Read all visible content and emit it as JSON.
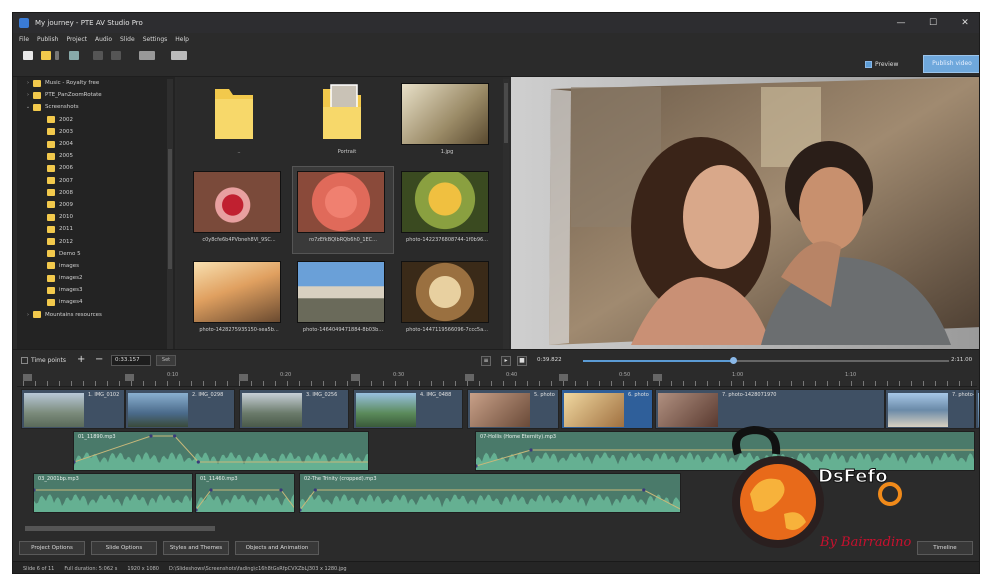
{
  "window": {
    "title": "My journey - PTE AV Studio Pro"
  },
  "menu": [
    "File",
    "Publish",
    "Project",
    "Audio",
    "Slide",
    "Settings",
    "Help"
  ],
  "toolbar": {
    "preview_label": "Preview",
    "right_button_label": "Publish video"
  },
  "tree": {
    "items": [
      {
        "label": "Music - Royalty free",
        "arrow": "›"
      },
      {
        "label": "PTE_PanZoomRotate",
        "arrow": "›"
      },
      {
        "label": "Screenshots",
        "arrow": "⌄"
      },
      {
        "label": "2002",
        "arrow": ""
      },
      {
        "label": "2003",
        "arrow": ""
      },
      {
        "label": "2004",
        "arrow": ""
      },
      {
        "label": "2005",
        "arrow": ""
      },
      {
        "label": "2006",
        "arrow": ""
      },
      {
        "label": "2007",
        "arrow": ""
      },
      {
        "label": "2008",
        "arrow": ""
      },
      {
        "label": "2009",
        "arrow": ""
      },
      {
        "label": "2010",
        "arrow": ""
      },
      {
        "label": "2011",
        "arrow": ""
      },
      {
        "label": "2012",
        "arrow": ""
      },
      {
        "label": "Demo 5",
        "arrow": ""
      },
      {
        "label": "images",
        "arrow": ""
      },
      {
        "label": "images2",
        "arrow": ""
      },
      {
        "label": "images3",
        "arrow": ""
      },
      {
        "label": "images4",
        "arrow": ""
      },
      {
        "label": "Mountains resources",
        "arrow": "›"
      }
    ]
  },
  "files": [
    {
      "label": "..",
      "kind": "folder"
    },
    {
      "label": "Portrait",
      "kind": "folder-photo"
    },
    {
      "label": "1.jpg",
      "kind": "couple"
    },
    {
      "label": "c0y8cfe6b4PVbneh8Vl_9SC...",
      "kind": "berries"
    },
    {
      "label": "ro7zEfkBQIbRQb6h0_1EC...",
      "kind": "flowers-pink",
      "selected": true
    },
    {
      "label": "photo-1422376808744-1f0b96...",
      "kind": "flowers-yellow"
    },
    {
      "label": "photo-1428275935150-sea5b...",
      "kind": "sunset"
    },
    {
      "label": "photo-1464049471884-8b03b...",
      "kind": "mountains"
    },
    {
      "label": "photo-1447119566096-7ccc5a...",
      "kind": "plate"
    }
  ],
  "midbar": {
    "time_points_label": "Time points",
    "time_value": "0:33.157",
    "set_label": "Set",
    "current_time": "0:39.822",
    "total_time": "2:11.00",
    "progress": 0.41
  },
  "ruler": {
    "labels": [
      "0:10",
      "0:20",
      "0:30",
      "0:40",
      "0:50",
      "1:00",
      "1:10",
      "1:20"
    ]
  },
  "slides": [
    {
      "label": "1. IMG_0102"
    },
    {
      "label": "2. IMG_0298"
    },
    {
      "label": "3. IMG_0256"
    },
    {
      "label": "4. IMG_0488"
    },
    {
      "label": "5. photo"
    },
    {
      "label": "6. photo"
    },
    {
      "label": "7. photo-1428071970"
    },
    {
      "label": "7. photo-1423881771509-53a40c..."
    },
    {
      "label": ""
    }
  ],
  "audio": [
    {
      "label": "01_11890.mp3"
    },
    {
      "label": "07-Hollis (Home Eternity).mp3"
    },
    {
      "label": "03_2001bp.mp3"
    },
    {
      "label": "01_11460.mp3"
    },
    {
      "label": "02-The Trinity (cropped).mp3"
    }
  ],
  "bottom_buttons": [
    "Project Options",
    "Slide Options",
    "Styles and Themes",
    "Objects and Animation"
  ],
  "timeline_button": "Timeline",
  "status": [
    "Slide 6 of 11",
    "Full duration: 5:062 s",
    "1920 x 1080",
    "D:\\Slideshows\\Screenshots\\fading\\c16h8tGsRfpCVXZbLJ303 x 1280.jpg"
  ],
  "watermark": {
    "brand": "DsFefo",
    "tagline": "By Bairradino"
  }
}
